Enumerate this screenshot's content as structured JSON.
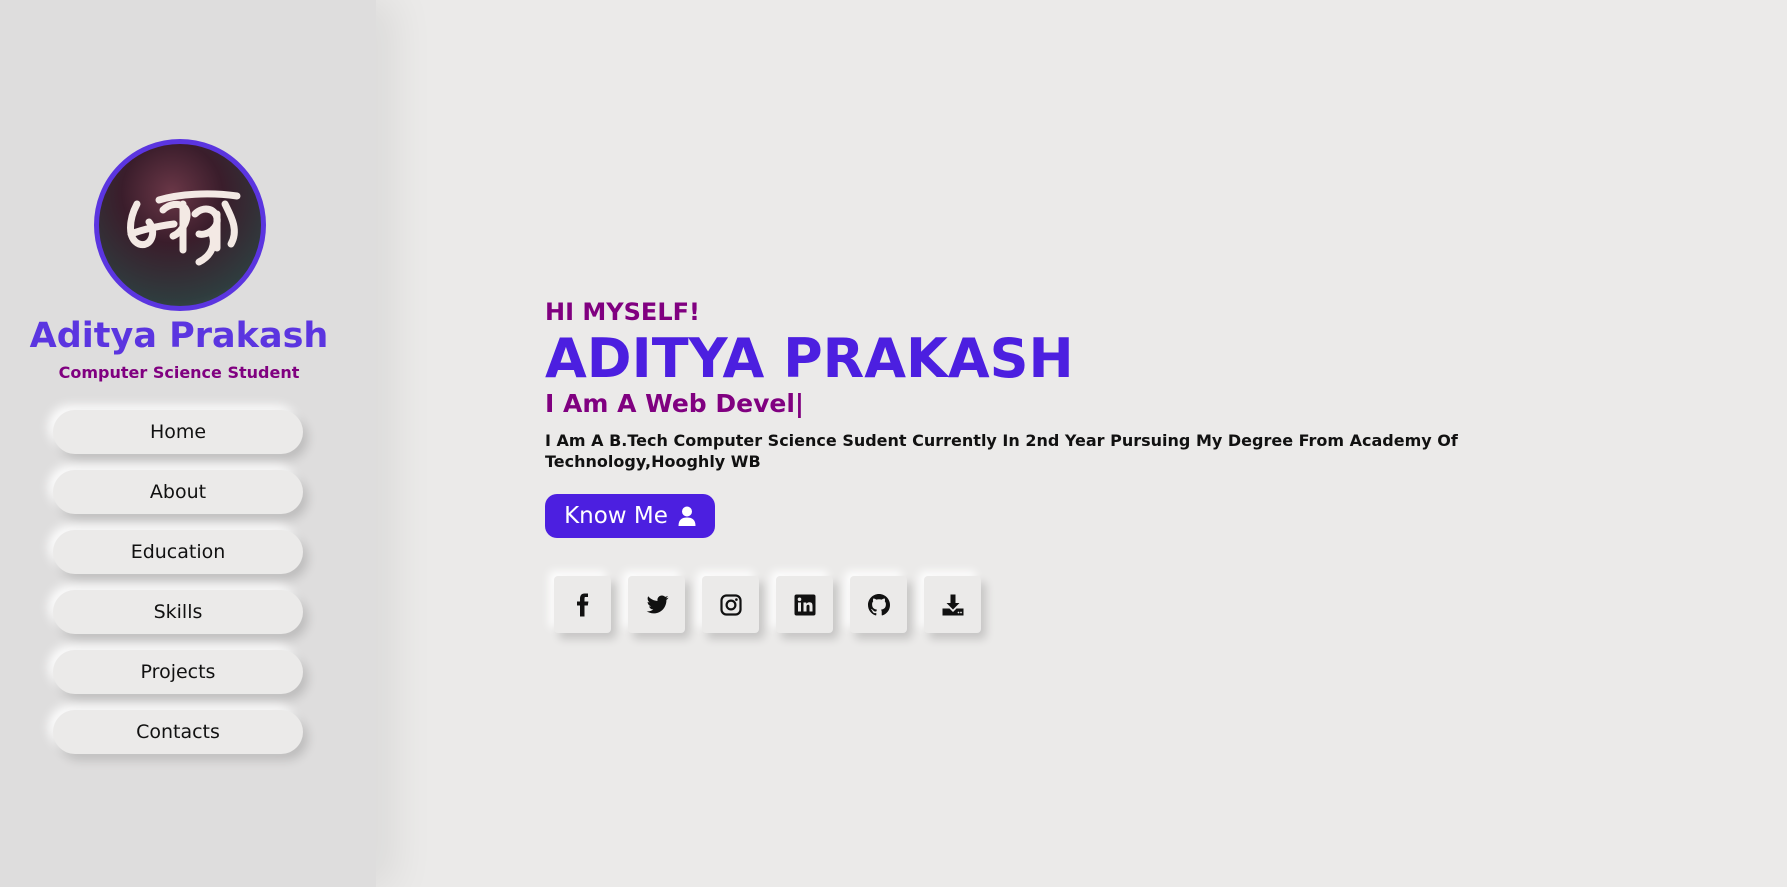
{
  "colors": {
    "accent": "#4c1fe0",
    "sidebar_name": "#5b35e0",
    "purple_text": "#800080",
    "page_bg": "#ebeae9",
    "sidebar_bg": "#dedddd"
  },
  "sidebar": {
    "avatar_icon": "calligraphy-logo",
    "name": "Aditya Prakash",
    "role": "Computer Science Student",
    "nav": [
      {
        "label": "Home"
      },
      {
        "label": "About"
      },
      {
        "label": "Education"
      },
      {
        "label": "Skills"
      },
      {
        "label": "Projects"
      },
      {
        "label": "Contacts"
      }
    ]
  },
  "hero": {
    "greeting": "HI MYSELF!",
    "name": "ADITYA PRAKASH",
    "typed_text": "I Am A Web Devel|",
    "bio": "I Am A B.Tech Computer Science Sudent Currently In 2nd Year Pursuing My Degree From Academy Of Technology,Hooghly WB",
    "cta_label": "Know Me",
    "cta_icon": "user-icon"
  },
  "socials": [
    {
      "icon": "facebook-icon"
    },
    {
      "icon": "twitter-icon"
    },
    {
      "icon": "instagram-icon"
    },
    {
      "icon": "linkedin-icon"
    },
    {
      "icon": "github-icon"
    },
    {
      "icon": "download-icon"
    }
  ]
}
